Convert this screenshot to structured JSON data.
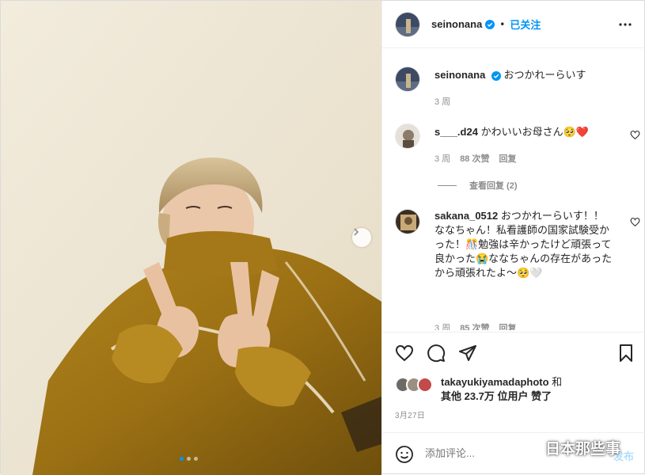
{
  "post": {
    "author": "seinonana",
    "follow_status": "已关注",
    "separator": "•",
    "photo_alt": "Photo by seinonana",
    "carousel": {
      "count": 3,
      "active_index": 0
    }
  },
  "caption": {
    "username": "seinonana",
    "text": "おつかれーらいす",
    "time": "3 周"
  },
  "comments": [
    {
      "username": "s___.d24",
      "text": "かわいいお母さん🥺❤️",
      "time": "3 周",
      "likes": "88 次赞",
      "reply_label": "回复"
    },
    {
      "username": "sakana_0512",
      "text": "おつかれーらいす！！ななちゃん！私看護師の国家試験受かった！🎊勉強は辛かったけど頑張って良かった😭ななちゃんの存在があったから頑張れたよ〜🥺🤍",
      "time": "3 周",
      "likes": "85 次赞",
      "reply_label": "回复"
    }
  ],
  "view_replies": "查看回复 (2)",
  "likes": {
    "liker": "takayukiyamadaphoto",
    "and": "和",
    "others_text": "其他 23.7万 位用户 赞了"
  },
  "date": "3月27日",
  "add_comment": {
    "placeholder": "添加评论...",
    "post_label": "发布"
  },
  "watermark": {
    "text": "日本那些事"
  },
  "colors": {
    "accent": "#0095f6",
    "muted": "#8e8e8e",
    "border": "#efefef"
  }
}
